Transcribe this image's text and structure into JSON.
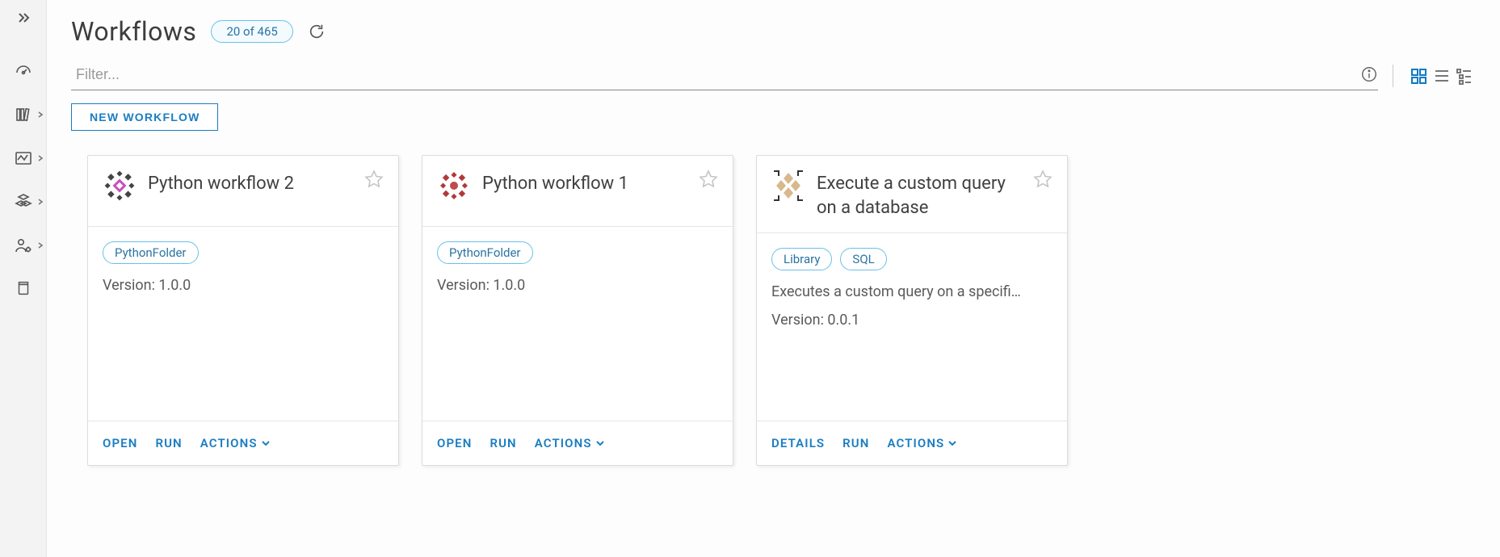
{
  "header": {
    "title": "Workflows",
    "count_label": "20 of 465"
  },
  "filter": {
    "placeholder": "Filter..."
  },
  "buttons": {
    "new_workflow": "NEW WORKFLOW"
  },
  "actions": {
    "open": "OPEN",
    "run": "RUN",
    "actions": "ACTIONS",
    "details": "DETAILS"
  },
  "cards": [
    {
      "title": "Python workflow 2",
      "tags": [
        "PythonFolder"
      ],
      "version": "Version: 1.0.0",
      "description": "",
      "footer": [
        "open",
        "run",
        "actions"
      ],
      "icon": "magenta"
    },
    {
      "title": "Python workflow 1",
      "tags": [
        "PythonFolder"
      ],
      "version": "Version: 1.0.0",
      "description": "",
      "footer": [
        "open",
        "run",
        "actions"
      ],
      "icon": "red"
    },
    {
      "title": "Execute a custom query on a database",
      "tags": [
        "Library",
        "SQL"
      ],
      "version": "Version: 0.0.1",
      "description": "Executes a custom query on a specifi…",
      "footer": [
        "details",
        "run",
        "actions"
      ],
      "icon": "tan"
    }
  ]
}
